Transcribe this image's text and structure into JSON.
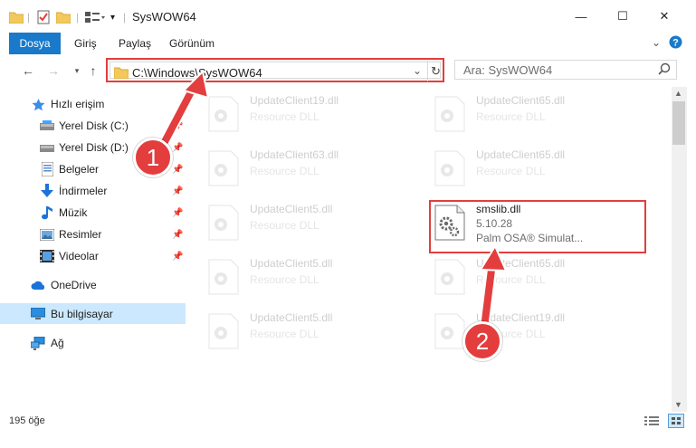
{
  "window": {
    "title": "SysWOW64",
    "controls": {
      "minimize": "—",
      "maximize": "☐",
      "close": "✕"
    }
  },
  "ribbon": {
    "tabs": [
      "Dosya",
      "Giriş",
      "Paylaş",
      "Görünüm"
    ],
    "expand_icon": "chevron-down-icon",
    "help_icon": "help-icon"
  },
  "address_bar": {
    "path": "C:\\Windows\\SysWOW64",
    "search_placeholder": "Ara: SysWOW64"
  },
  "sidebar": {
    "items": [
      {
        "label": "Hızlı erişim",
        "icon": "star-icon"
      },
      {
        "label": "Yerel Disk (C:)",
        "icon": "drive-icon",
        "pinned": true
      },
      {
        "label": "Yerel Disk (D:)",
        "icon": "drive-icon",
        "pinned": true
      },
      {
        "label": "Belgeler",
        "icon": "documents-icon",
        "pinned": true
      },
      {
        "label": "İndirmeler",
        "icon": "download-icon",
        "pinned": true
      },
      {
        "label": "Müzik",
        "icon": "music-icon",
        "pinned": true
      },
      {
        "label": "Resimler",
        "icon": "pictures-icon",
        "pinned": true
      },
      {
        "label": "Videolar",
        "icon": "videos-icon",
        "pinned": true
      },
      {
        "label": "OneDrive",
        "icon": "cloud-icon"
      },
      {
        "label": "Bu bilgisayar",
        "icon": "computer-icon",
        "selected": true
      },
      {
        "label": "Ağ",
        "icon": "network-icon"
      }
    ]
  },
  "files": [
    {
      "name": "UpdateClient19.dll",
      "sub": "Resource DLL",
      "faded": true
    },
    {
      "name": "UpdateClient65.dll",
      "sub": "Resource DLL",
      "faded": true
    },
    {
      "name": "UpdateClient63.dll",
      "sub": "Resource DLL",
      "faded": true
    },
    {
      "name": "UpdateClient65.dll",
      "sub": "Resource DLL",
      "faded": true
    },
    {
      "name": "UpdateClient5.dll",
      "sub": "Resource DLL",
      "faded": true
    },
    {
      "name": "smslib.dll",
      "sub": "5.10.28",
      "sub2": "Palm OSA® Simulat...",
      "faded": false
    },
    {
      "name": "UpdateClient5.dll",
      "sub": "Resource DLL",
      "faded": true
    },
    {
      "name": "UpdateClient65.dll",
      "sub": "Resource DLL",
      "faded": true
    },
    {
      "name": "UpdateClient5.dll",
      "sub": "Resource DLL",
      "faded": true
    },
    {
      "name": "UpdateClient19.dll",
      "sub": "Resource DLL",
      "faded": true
    }
  ],
  "annotations": {
    "step1": "1",
    "step2": "2"
  },
  "status": {
    "item_count": "195 öğe"
  },
  "colors": {
    "accent": "#1979ca",
    "highlight": "#e33d3d",
    "selected_bg": "#cce8ff"
  }
}
